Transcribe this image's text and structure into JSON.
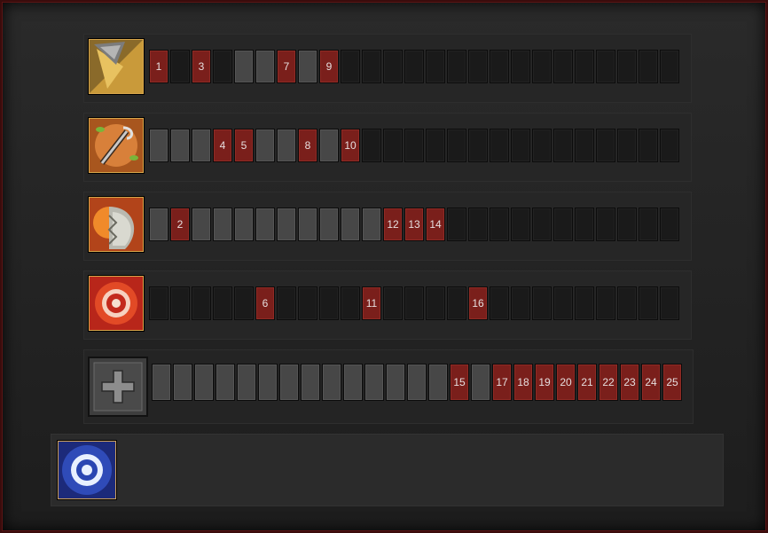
{
  "skills": [
    {
      "icon": "drill-blade-icon",
      "slots": [
        "r:1",
        "e",
        "r:3",
        "e",
        "g",
        "g",
        "r:7",
        "g",
        "r:9",
        "e",
        "e",
        "e",
        "e",
        "e",
        "e",
        "e",
        "e",
        "e",
        "e",
        "e",
        "e",
        "e",
        "e",
        "e",
        "e"
      ]
    },
    {
      "icon": "grappling-hook-icon",
      "slots": [
        "g",
        "g",
        "g",
        "r:4",
        "r:5",
        "g",
        "g",
        "r:8",
        "g",
        "r:10",
        "e",
        "e",
        "e",
        "e",
        "e",
        "e",
        "e",
        "e",
        "e",
        "e",
        "e",
        "e",
        "e",
        "e",
        "e"
      ]
    },
    {
      "icon": "armor-shield-icon",
      "slots": [
        "g",
        "r:2",
        "g",
        "g",
        "g",
        "g",
        "g",
        "g",
        "g",
        "g",
        "g",
        "r:12",
        "r:13",
        "r:14",
        "e",
        "e",
        "e",
        "e",
        "e",
        "e",
        "e",
        "e",
        "e",
        "e",
        "e"
      ]
    },
    {
      "icon": "sawblade-icon",
      "slots": [
        "e",
        "e",
        "e",
        "e",
        "e",
        "r:6",
        "e",
        "e",
        "e",
        "e",
        "r:11",
        "e",
        "e",
        "e",
        "e",
        "r:16",
        "e",
        "e",
        "e",
        "e",
        "e",
        "e",
        "e",
        "e",
        "e"
      ]
    }
  ],
  "talents": {
    "icon": "plus-icon",
    "slots": [
      "g",
      "g",
      "g",
      "g",
      "g",
      "g",
      "g",
      "g",
      "g",
      "g",
      "g",
      "g",
      "g",
      "g",
      "r:15",
      "g",
      "r:17",
      "r:18",
      "r:19",
      "r:20",
      "r:21",
      "r:22",
      "r:23",
      "r:24",
      "r:25"
    ]
  },
  "ultimate": {
    "icon": "blue-sawblade-icon"
  }
}
